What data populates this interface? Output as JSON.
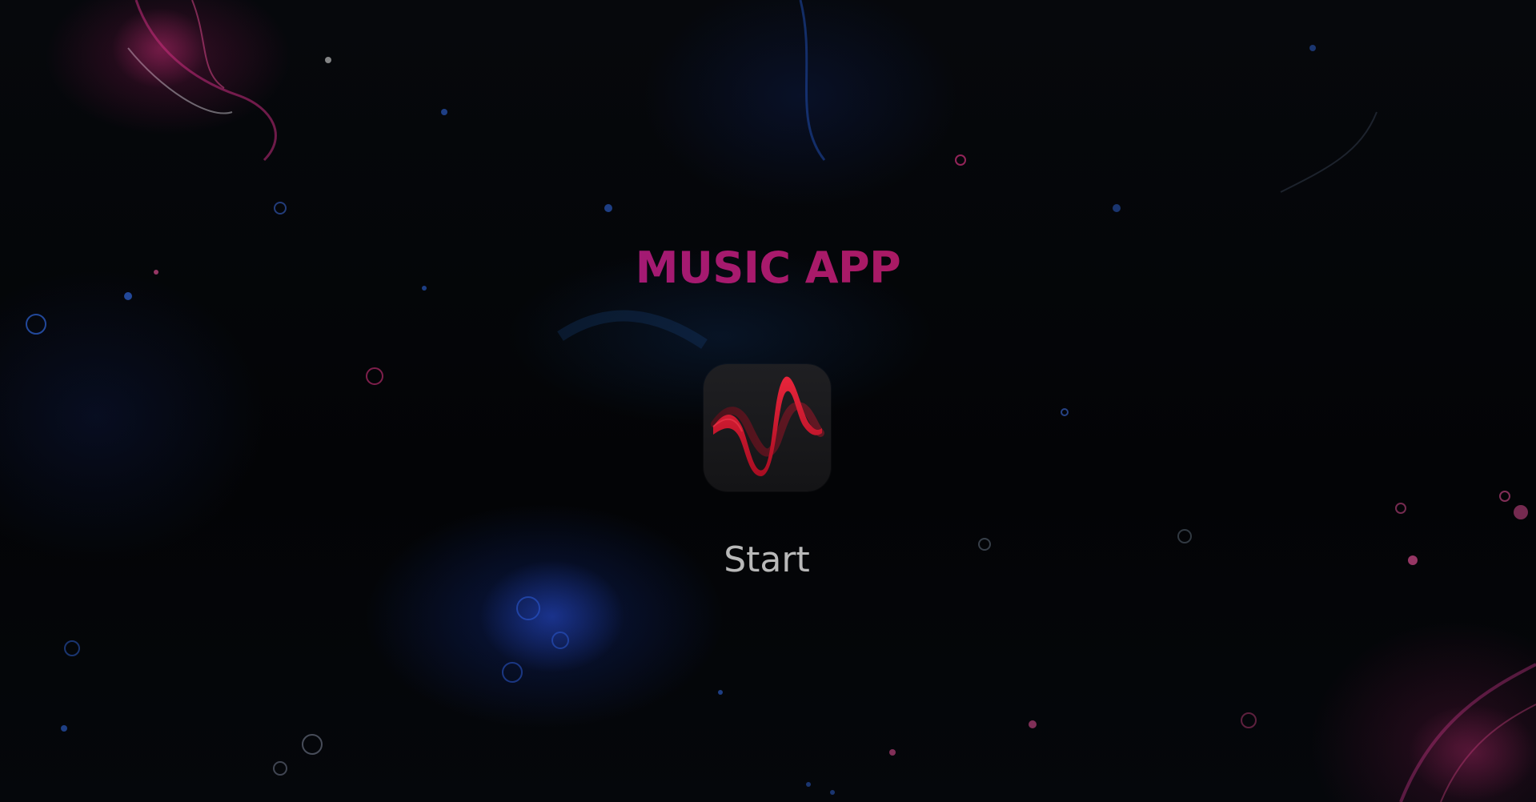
{
  "app": {
    "title": "MUSIC APP",
    "start_label": "Start",
    "icon": "waveform-icon"
  },
  "colors": {
    "title_gradient_start": "#8a1a95",
    "title_gradient_end": "#b01c3e",
    "icon_accent": "#d4142e",
    "icon_background": "#1a1a1c",
    "start_text": "#b9b9b9"
  }
}
